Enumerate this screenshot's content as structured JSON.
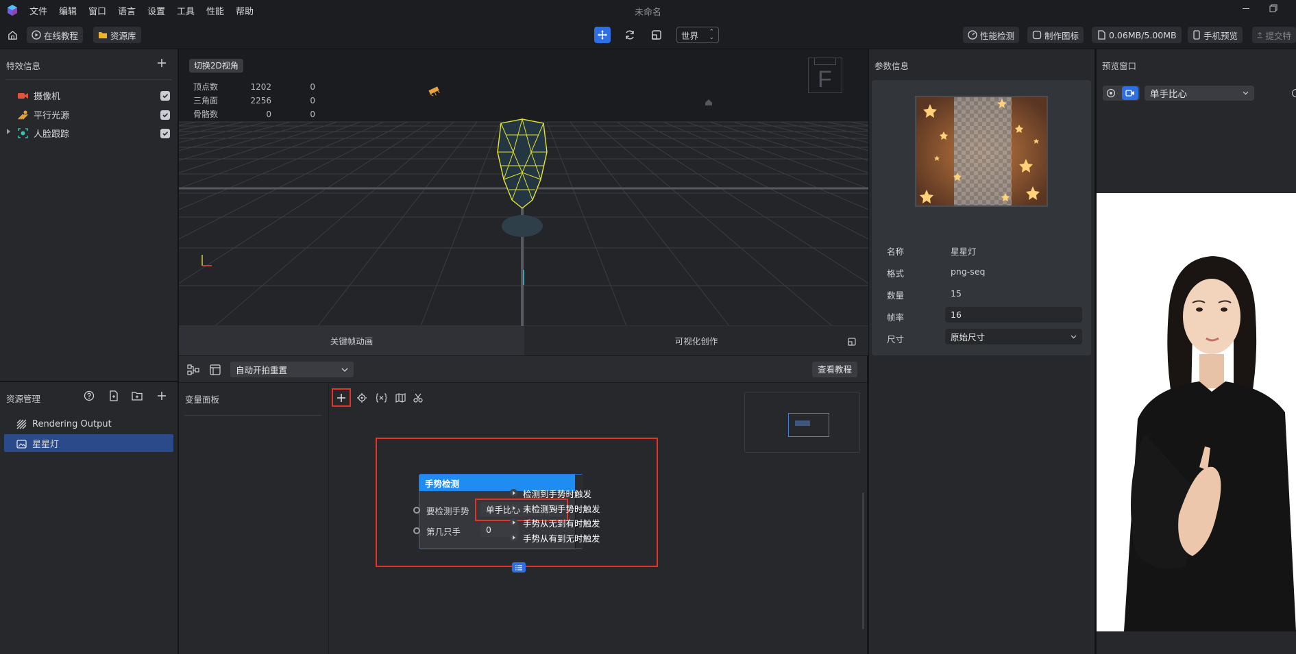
{
  "app": {
    "title": "未命名"
  },
  "menu": [
    "文件",
    "编辑",
    "窗口",
    "语言",
    "设置",
    "工具",
    "性能",
    "帮助"
  ],
  "toolbar": {
    "tutorial": "在线教程",
    "library": "资源库",
    "space_select": "世界",
    "perf_check": "性能检测",
    "make_icon": "制作图标",
    "size_info": "0.06MB/5.00MB",
    "phone_preview": "手机预览",
    "submit": "提交特"
  },
  "effects_panel": {
    "title": "特效信息",
    "items": [
      {
        "label": "摄像机",
        "checked": true,
        "icon": "camera-icon",
        "color": "#e5533c"
      },
      {
        "label": "平行光源",
        "checked": true,
        "icon": "light-icon",
        "color": "#e6a23c"
      },
      {
        "label": "人脸跟踪",
        "checked": true,
        "icon": "face-tracking-icon",
        "color": "#35c4b0"
      }
    ]
  },
  "viewport": {
    "toggle_2d": "切换2D视角",
    "stats": [
      {
        "label": "顶点数",
        "v1": "1202",
        "v2": "0"
      },
      {
        "label": "三角面",
        "v1": "2256",
        "v2": "0"
      },
      {
        "label": "骨骼数",
        "v1": "0",
        "v2": "0"
      }
    ],
    "gizmo_label": "F"
  },
  "bottom_tabs": {
    "keyframe": "关键帧动画",
    "visual": "可视化创作"
  },
  "graph_toolbar": {
    "dropdown": "自动开拍重置",
    "tutorial": "查看教程"
  },
  "assets_panel": {
    "title": "资源管理",
    "items": [
      {
        "label": "Rendering Output",
        "selected": false
      },
      {
        "label": "星星灯",
        "selected": true
      }
    ]
  },
  "variables_panel": {
    "title": "变量面板"
  },
  "node": {
    "title": "手势检测",
    "gesture_label": "要检测手势",
    "gesture_value": "单手比心",
    "hand_label": "第几只手",
    "hand_value": "0",
    "outputs": [
      "检测到手势时触发",
      "未检测到手势时触发",
      "手势从无到有时触发",
      "手势从有到无时触发"
    ]
  },
  "params_panel": {
    "title": "参数信息",
    "props": {
      "name_label": "名称",
      "name_value": "星星灯",
      "format_label": "格式",
      "format_value": "png-seq",
      "count_label": "数量",
      "count_value": "15",
      "fps_label": "帧率",
      "fps_value": "16",
      "size_label": "尺寸",
      "size_value": "原始尺寸"
    }
  },
  "preview_panel": {
    "title": "预览窗口",
    "gesture_select": "单手比心"
  },
  "colors": {
    "accent": "#2f6fe6",
    "node_header": "#1e8cf0",
    "highlight": "#e5332a",
    "selected_row": "#2b4a8a"
  }
}
